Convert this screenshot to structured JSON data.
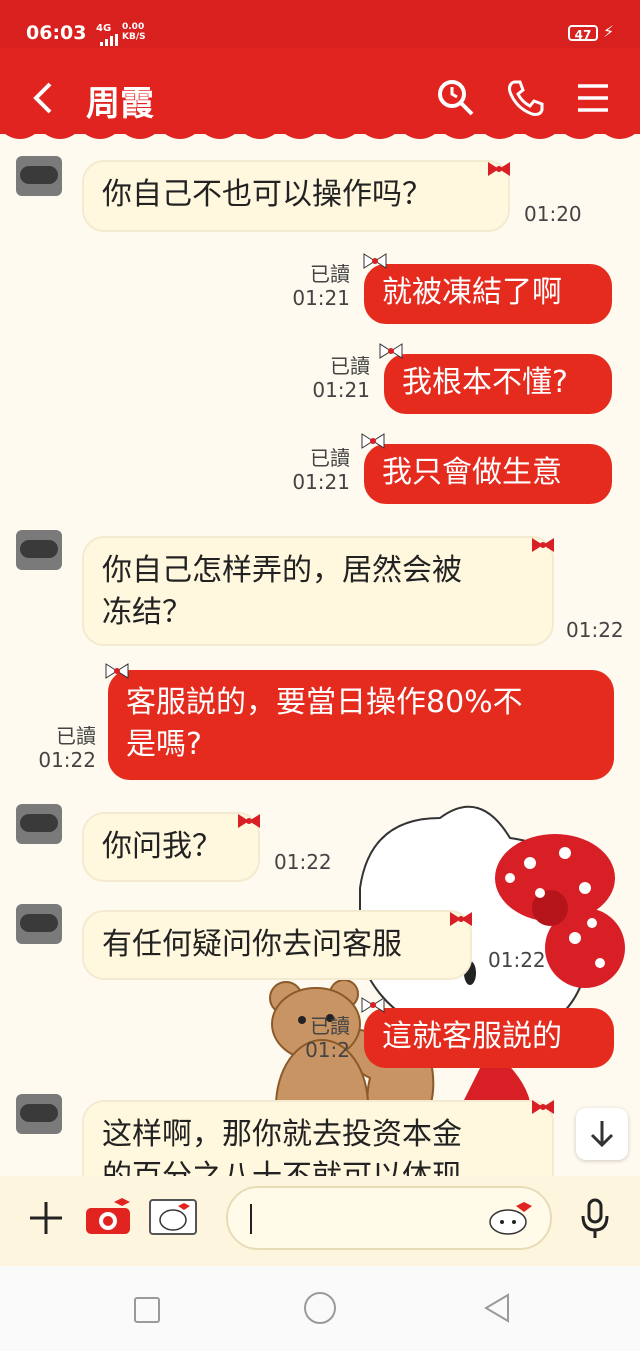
{
  "status": {
    "time": "06:03",
    "network": "4G",
    "speed_value": "0.00",
    "speed_unit": "KB/S",
    "battery": "47"
  },
  "header": {
    "contact_name": "周霞",
    "back_icon": "chevron-left-icon",
    "icons": [
      "search-icon",
      "phone-icon",
      "menu-icon"
    ]
  },
  "messages": [
    {
      "dir": "in",
      "text": "你自己不也可以操作吗？",
      "time": "01:20"
    },
    {
      "dir": "out",
      "text": "就被凍結了啊",
      "read": "已讀",
      "time": "01:21"
    },
    {
      "dir": "out",
      "text": "我根本不懂?",
      "read": "已讀",
      "time": "01:21"
    },
    {
      "dir": "out",
      "text": "我只會做生意",
      "read": "已讀",
      "time": "01:21"
    },
    {
      "dir": "in",
      "line1": "你自己怎样弄的，居然会被",
      "line2": "冻结？",
      "time": "01:22"
    },
    {
      "dir": "out",
      "line1": "客服説的，要當日操作80%不",
      "line2": "是嗎?",
      "read": "已讀",
      "time": "01:22"
    },
    {
      "dir": "in",
      "text": "你问我？",
      "time": "01:22"
    },
    {
      "dir": "in",
      "text": "有任何疑问你去问客服",
      "time": "01:22"
    },
    {
      "dir": "out",
      "text": "這就客服説的",
      "read": "已讀",
      "time": "01:2"
    },
    {
      "dir": "in",
      "line1": "这样啊，那你就去投资本金",
      "line2": "的百分之八十不就可以体现"
    }
  ],
  "colors": {
    "header_red": "#e12420",
    "bubble_out": "#e52a1e",
    "bubble_in": "#fff8df",
    "background": "#fffaf0"
  }
}
